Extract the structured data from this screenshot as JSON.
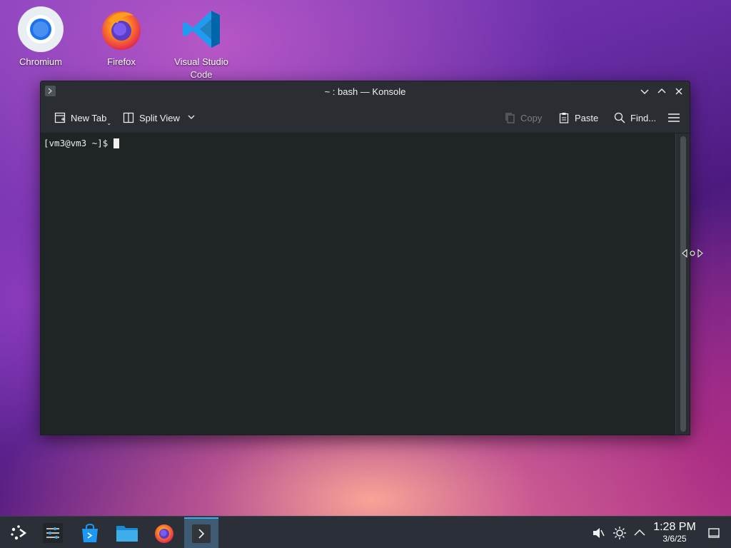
{
  "desktop": {
    "icons": [
      {
        "label": "Chromium",
        "icon": "chromium-icon"
      },
      {
        "label": "Firefox",
        "icon": "firefox-icon"
      },
      {
        "label": "Visual Studio Code",
        "icon": "vscode-icon"
      }
    ]
  },
  "window": {
    "title": "~ : bash — Konsole",
    "toolbar": {
      "new_tab": "New Tab",
      "split_view": "Split View",
      "copy": "Copy",
      "paste": "Paste",
      "find": "Find..."
    },
    "terminal": {
      "prompt": "[vm3@vm3 ~]$"
    }
  },
  "taskbar": {
    "time": "1:28 PM",
    "date": "3/6/25",
    "apps": [
      "application-launcher-icon",
      "system-settings-icon",
      "discover-icon",
      "file-manager-icon",
      "firefox-icon",
      "konsole-icon"
    ],
    "active_app": "konsole-icon"
  },
  "colors": {
    "accent": "#3daee9",
    "terminal_bg": "#1f2524",
    "window_bg": "#2a2e32",
    "taskbar_bg": "#2b2f38"
  }
}
